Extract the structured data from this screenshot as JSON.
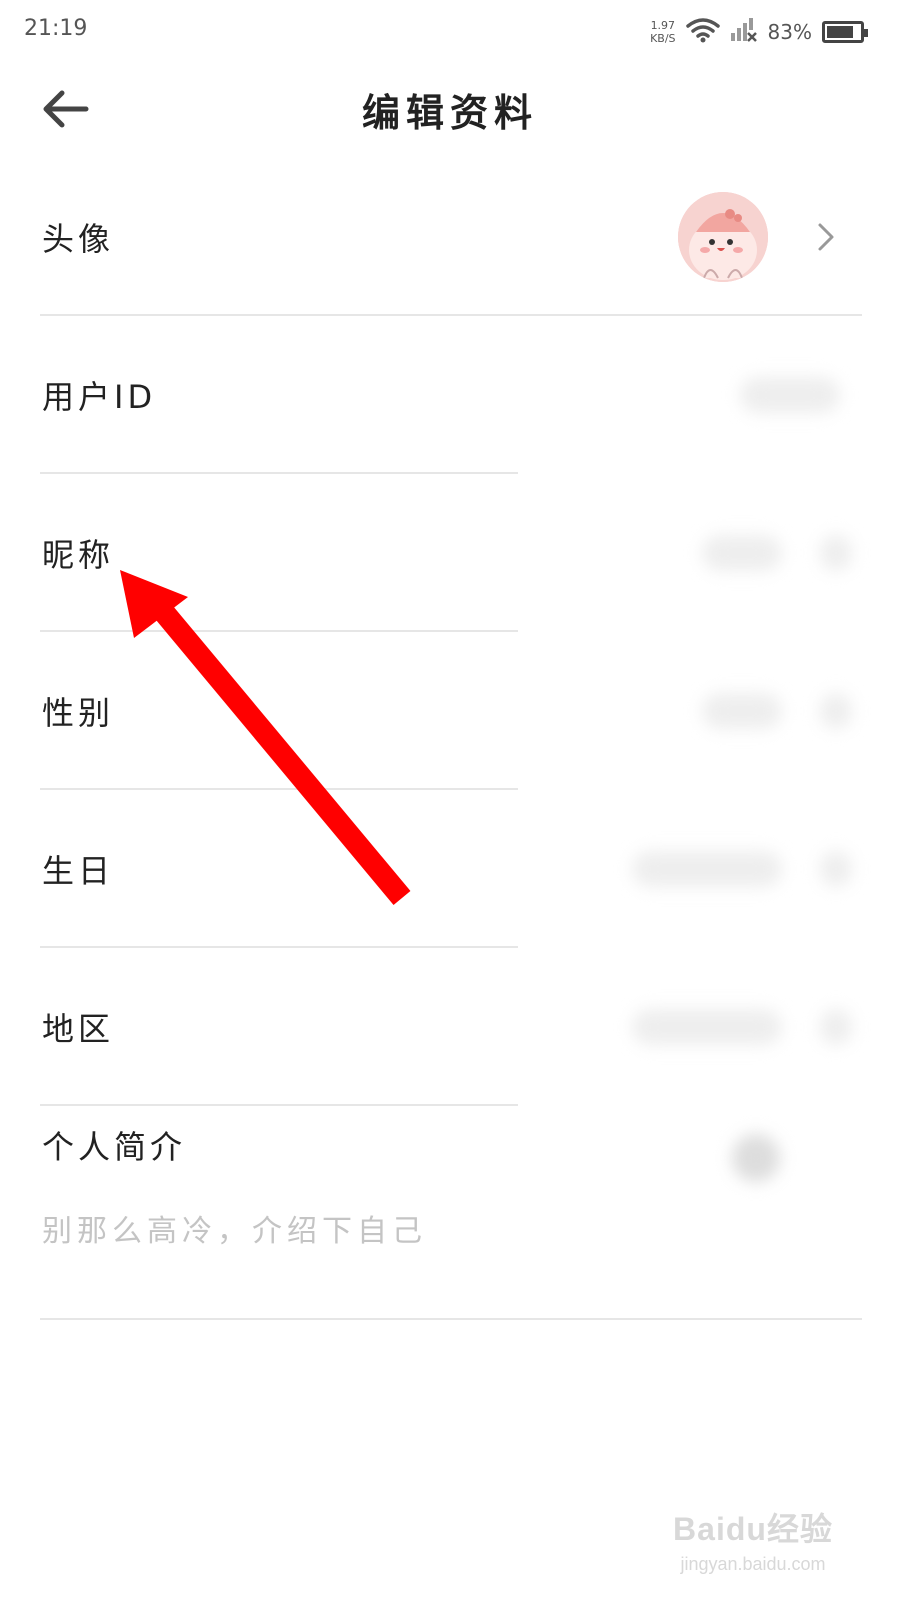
{
  "status_bar": {
    "time": "21:19",
    "net_speed_value": "1.97",
    "net_speed_unit": "KB/S",
    "battery": "83%",
    "battery_level": 0.83,
    "icons": [
      "wifi-icon",
      "signal-off-icon",
      "battery-icon"
    ]
  },
  "header": {
    "title": "编辑资料",
    "back_icon": "back-arrow-icon"
  },
  "rows": {
    "avatar": {
      "label": "头像"
    },
    "user_id": {
      "label": "用户ID"
    },
    "nickname": {
      "label": "昵称"
    },
    "gender": {
      "label": "性别"
    },
    "birthday": {
      "label": "生日"
    },
    "region": {
      "label": "地区"
    }
  },
  "bio": {
    "label": "个人简介",
    "placeholder": "别那么高冷，介绍下自己"
  },
  "annotation": {
    "color": "#ff0000",
    "target": "nickname"
  },
  "watermark": {
    "logo": "Baidu经验",
    "url": "jingyan.baidu.com"
  }
}
